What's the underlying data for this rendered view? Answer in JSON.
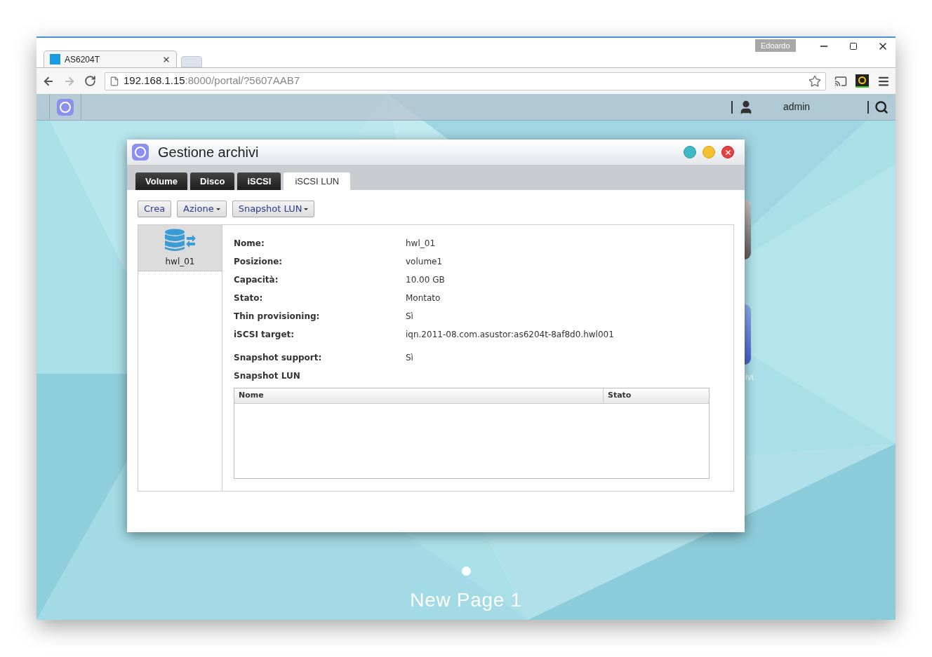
{
  "browser": {
    "user_badge": "Edoardo",
    "tabs": [
      {
        "title": "AS6204T",
        "selected": true
      }
    ],
    "url_host": "192.168.1.15",
    "url_rest": ":8000/portal/?5607AAB7"
  },
  "portal": {
    "user": "admin"
  },
  "desktop": {
    "icons": [
      {
        "kind": "gray"
      },
      {
        "kind": "blue",
        "label": "ivi"
      }
    ],
    "pages": [
      {
        "selected": true
      }
    ],
    "page_label": "New Page 1"
  },
  "window": {
    "title": "Gestione archivi",
    "tabs": [
      {
        "label": "Volume",
        "selected": false
      },
      {
        "label": "Disco",
        "selected": false
      },
      {
        "label": "iSCSI",
        "selected": false
      },
      {
        "label": "iSCSI LUN",
        "selected": true
      }
    ],
    "toolbar": [
      {
        "label": "Crea",
        "dropdown": false
      },
      {
        "label": "Azione",
        "dropdown": true
      },
      {
        "label": "Snapshot LUN",
        "dropdown": true
      }
    ],
    "luns": [
      {
        "name": "hwl_01",
        "selected": true
      }
    ],
    "details": [
      {
        "label": "Nome:",
        "value": "hwl_01"
      },
      {
        "label": "Posizione:",
        "value": "volume1"
      },
      {
        "label": "Capacità:",
        "value": "10.00 GB"
      },
      {
        "label": "Stato:",
        "value": "Montato"
      },
      {
        "label": "Thin provisioning:",
        "value": "Sì"
      },
      {
        "label": "iSCSI target:",
        "value": "iqn.2011-08.com.asustor:as6204t-8af8d0.hwl001"
      },
      {
        "label": "Snapshot support:",
        "value": "Sì",
        "spaced": true
      }
    ],
    "snapshot_heading": "Snapshot LUN",
    "snapshot_table": {
      "columns": [
        "Nome",
        "Stato"
      ]
    }
  }
}
